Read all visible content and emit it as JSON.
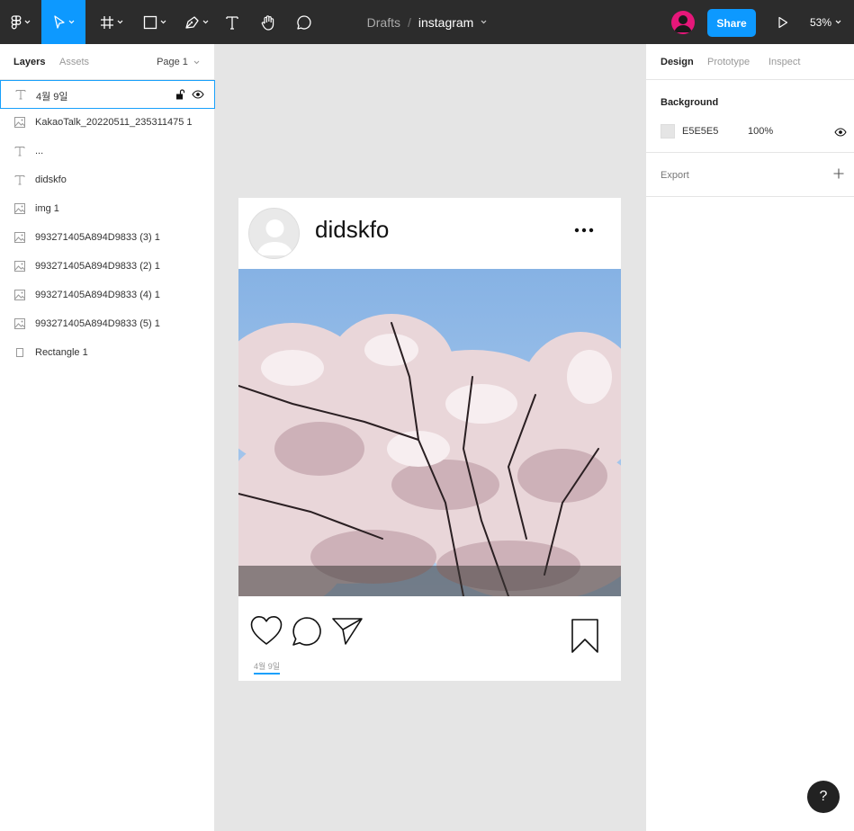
{
  "toolbar": {
    "drafts": "Drafts",
    "separator": "/",
    "file_name": "instagram",
    "share_label": "Share",
    "zoom": "53%"
  },
  "left_panel": {
    "tabs": {
      "layers": "Layers",
      "assets": "Assets"
    },
    "page": "Page 1",
    "layers": [
      {
        "type": "text-icon",
        "name": "4월 9일"
      },
      {
        "type": "image-icon",
        "name": "KakaoTalk_20220511_235311475 1"
      },
      {
        "type": "text-icon",
        "name": "..."
      },
      {
        "type": "text-icon",
        "name": "didskfo"
      },
      {
        "type": "image-icon",
        "name": "img 1"
      },
      {
        "type": "image-icon",
        "name": "993271405A894D9833 (3) 1"
      },
      {
        "type": "image-icon",
        "name": "993271405A894D9833 (2) 1"
      },
      {
        "type": "image-icon",
        "name": "993271405A894D9833 (4) 1"
      },
      {
        "type": "image-icon",
        "name": "993271405A894D9833 (5) 1"
      },
      {
        "type": "rectangle-icon",
        "name": "Rectangle 1"
      }
    ]
  },
  "right_panel": {
    "tabs": {
      "design": "Design",
      "prototype": "Prototype",
      "inspect": "Inspect"
    },
    "background": {
      "title": "Background",
      "hex": "E5E5E5",
      "opacity": "100%"
    },
    "export": {
      "title": "Export"
    }
  },
  "post": {
    "username": "didskfo",
    "caption": "4월 9일"
  },
  "help": "?",
  "colors": {
    "accent": "#0d99ff",
    "canvas": "#e5e5e5",
    "toolbar": "#2c2c2c"
  }
}
